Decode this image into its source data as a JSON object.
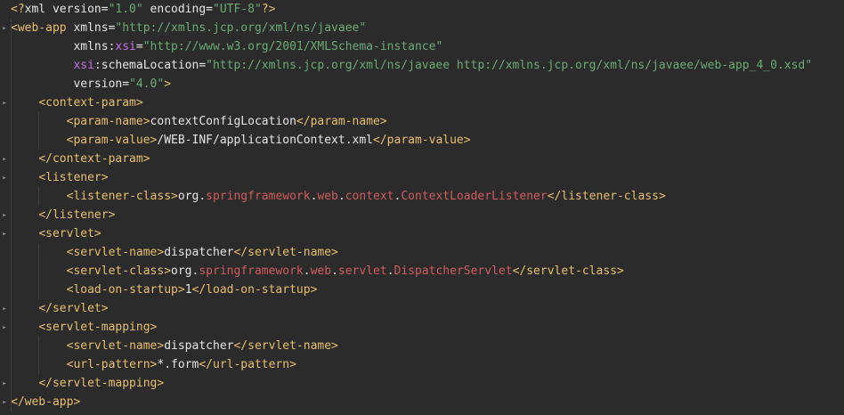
{
  "colors": {
    "background": "#2b2b2b",
    "tag": "#e8bf6a",
    "attribute": "#e6e6e6",
    "namespace": "#c771e4",
    "string": "#6aab73",
    "text": "#e6e6e6",
    "package": "#d05c5c"
  },
  "icons": {
    "fold": "fold-marker-icon"
  },
  "lines": [
    [
      [
        "tag",
        "<?"
      ],
      [
        "plain",
        "xml version="
      ],
      [
        "val",
        "\"1.0\""
      ],
      [
        "plain",
        " encoding="
      ],
      [
        "val",
        "\"UTF-8\""
      ],
      [
        "tag",
        "?>"
      ]
    ],
    [
      [
        "tag",
        "<web-app"
      ],
      [
        "attr",
        " xmlns="
      ],
      [
        "val",
        "\"http://xmlns.jcp.org/xml/ns/javaee\""
      ]
    ],
    [
      [
        "attr",
        "         xmlns:"
      ],
      [
        "ns",
        "xsi"
      ],
      [
        "attr",
        "="
      ],
      [
        "val",
        "\"http://www.w3.org/2001/XMLSchema-instance\""
      ]
    ],
    [
      [
        "ns",
        "         xsi"
      ],
      [
        "attr",
        ":schemaLocation="
      ],
      [
        "val",
        "\"http://xmlns.jcp.org/xml/ns/javaee http://xmlns.jcp.org/xml/ns/javaee/web-app_4_0.xsd\""
      ]
    ],
    [
      [
        "attr",
        "         version="
      ],
      [
        "val",
        "\"4.0\""
      ],
      [
        "tag",
        ">"
      ]
    ],
    [
      [
        "plain",
        "    "
      ],
      [
        "tag",
        "<context-param>"
      ]
    ],
    [
      [
        "plain",
        "        "
      ],
      [
        "tag",
        "<param-name>"
      ],
      [
        "text",
        "contextConfigLocation"
      ],
      [
        "tag",
        "</param-name>"
      ]
    ],
    [
      [
        "plain",
        "        "
      ],
      [
        "tag",
        "<param-value>"
      ],
      [
        "text",
        "/WEB-INF/applicationContext.xml"
      ],
      [
        "tag",
        "</param-value>"
      ]
    ],
    [
      [
        "plain",
        "    "
      ],
      [
        "tag",
        "</context-param>"
      ]
    ],
    [
      [
        "plain",
        "    "
      ],
      [
        "tag",
        "<listener>"
      ]
    ],
    [
      [
        "plain",
        "        "
      ],
      [
        "tag",
        "<listener-class>"
      ],
      [
        "text",
        "org."
      ],
      [
        "pkg",
        "springframework"
      ],
      [
        "text",
        "."
      ],
      [
        "pkg",
        "web"
      ],
      [
        "text",
        "."
      ],
      [
        "pkg",
        "context"
      ],
      [
        "text",
        "."
      ],
      [
        "pkg",
        "ContextLoaderListener"
      ],
      [
        "tag",
        "</listener-class>"
      ]
    ],
    [
      [
        "plain",
        "    "
      ],
      [
        "tag",
        "</listener>"
      ]
    ],
    [
      [
        "plain",
        "    "
      ],
      [
        "tag",
        "<servlet>"
      ]
    ],
    [
      [
        "plain",
        "        "
      ],
      [
        "tag",
        "<servlet-name>"
      ],
      [
        "text",
        "dispatcher"
      ],
      [
        "tag",
        "</servlet-name>"
      ]
    ],
    [
      [
        "plain",
        "        "
      ],
      [
        "tag",
        "<servlet-class>"
      ],
      [
        "text",
        "org."
      ],
      [
        "pkg",
        "springframework"
      ],
      [
        "text",
        "."
      ],
      [
        "pkg",
        "web"
      ],
      [
        "text",
        "."
      ],
      [
        "pkg",
        "servlet"
      ],
      [
        "text",
        "."
      ],
      [
        "pkg",
        "DispatcherServlet"
      ],
      [
        "tag",
        "</servlet-class>"
      ]
    ],
    [
      [
        "plain",
        "        "
      ],
      [
        "tag",
        "<load-on-startup>"
      ],
      [
        "text",
        "1"
      ],
      [
        "tag",
        "</load-on-startup>"
      ]
    ],
    [
      [
        "plain",
        "    "
      ],
      [
        "tag",
        "</servlet>"
      ]
    ],
    [
      [
        "plain",
        "    "
      ],
      [
        "tag",
        "<servlet-mapping>"
      ]
    ],
    [
      [
        "plain",
        "        "
      ],
      [
        "tag",
        "<servlet-name>"
      ],
      [
        "text",
        "dispatcher"
      ],
      [
        "tag",
        "</servlet-name>"
      ]
    ],
    [
      [
        "plain",
        "        "
      ],
      [
        "tag",
        "<url-pattern>"
      ],
      [
        "text",
        "*.form"
      ],
      [
        "tag",
        "</url-pattern>"
      ]
    ],
    [
      [
        "plain",
        "    "
      ],
      [
        "tag",
        "</servlet-mapping>"
      ]
    ],
    [
      [
        "tag",
        "</web-app>"
      ]
    ]
  ]
}
